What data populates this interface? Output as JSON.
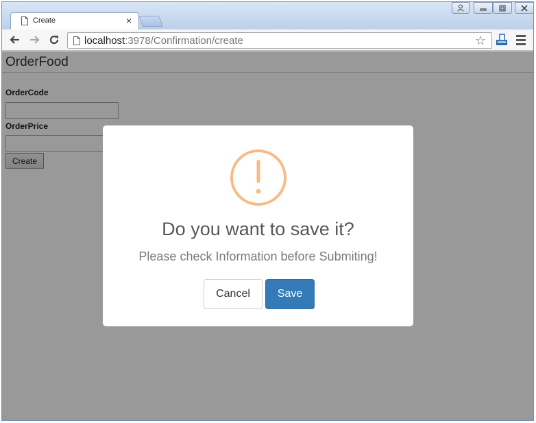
{
  "browser": {
    "tab_title": "Create",
    "tab_close": "×",
    "url_host": "localhost",
    "url_rest": ":3978/Confirmation/create"
  },
  "page": {
    "brand": "OrderFood",
    "fields": [
      {
        "label": "OrderCode",
        "value": ""
      },
      {
        "label": "OrderPrice",
        "value": ""
      }
    ],
    "create_label": "Create"
  },
  "dialog": {
    "title": "Do you want to save it?",
    "text": "Please check Information before Submiting!",
    "cancel_label": "Cancel",
    "save_label": "Save",
    "icon": "warning-icon",
    "icon_color": "#f8bb86",
    "save_color": "#337ab7"
  }
}
